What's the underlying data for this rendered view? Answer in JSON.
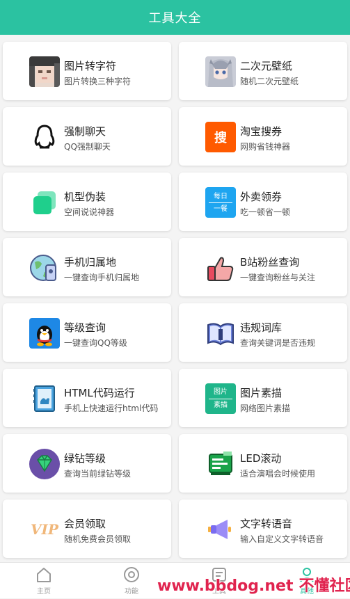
{
  "header": {
    "title": "工具大全"
  },
  "tools": [
    {
      "title": "图片转字符",
      "desc": "图片转换三种字符",
      "icon": "blurred-face-icon"
    },
    {
      "title": "二次元壁纸",
      "desc": "随机二次元壁纸",
      "icon": "anime-girl-icon"
    },
    {
      "title": "强制聊天",
      "desc": "QQ强制聊天",
      "icon": "penguin-outline-icon"
    },
    {
      "title": "淘宝搜券",
      "desc": "网购省钱神器",
      "icon": "taobao-search-icon",
      "icon_text": "搜"
    },
    {
      "title": "机型伪装",
      "desc": "空间说说神器",
      "icon": "stacked-squares-icon"
    },
    {
      "title": "外卖领券",
      "desc": "吃一顿省一顿",
      "icon": "calendar-badge-icon",
      "icon_text_1": "每日",
      "icon_text_2": "一餐"
    },
    {
      "title": "手机归属地",
      "desc": "一键查询手机归属地",
      "icon": "globe-phone-icon"
    },
    {
      "title": "B站粉丝查询",
      "desc": "一键查询粉丝与关注",
      "icon": "thumbs-up-icon"
    },
    {
      "title": "等级查询",
      "desc": "一键查询QQ等级",
      "icon": "qq-penguin-icon"
    },
    {
      "title": "违规词库",
      "desc": "查询关键词是否违规",
      "icon": "open-book-icon"
    },
    {
      "title": "HTML代码运行",
      "desc": "手机上快速运行html代码",
      "icon": "code-notebook-icon"
    },
    {
      "title": "图片素描",
      "desc": "网络图片素描",
      "icon": "image-sketch-icon",
      "icon_text_1": "图片",
      "icon_text_2": "素描"
    },
    {
      "title": "绿钻等级",
      "desc": "查询当前绿钻等级",
      "icon": "green-diamond-icon"
    },
    {
      "title": "LED滚动",
      "desc": "适合演唱会时候使用",
      "icon": "led-sign-icon"
    },
    {
      "title": "会员领取",
      "desc": "随机免费会员领取",
      "icon": "vip-icon",
      "icon_text": "VIP"
    },
    {
      "title": "文字转语音",
      "desc": "输入自定义文字转语音",
      "icon": "megaphone-icon"
    }
  ],
  "tabbar": [
    {
      "label": "主页",
      "icon": "home-icon"
    },
    {
      "label": "功能",
      "icon": "compass-icon"
    },
    {
      "label": "工具",
      "icon": "document-icon"
    },
    {
      "label": "其他",
      "icon": "person-icon",
      "active": true
    }
  ],
  "watermark": {
    "site": "www.bbdog.net",
    "name": "不懂社区"
  },
  "colors": {
    "accent": "#2bc2a1",
    "watermark": "#e0234e"
  }
}
